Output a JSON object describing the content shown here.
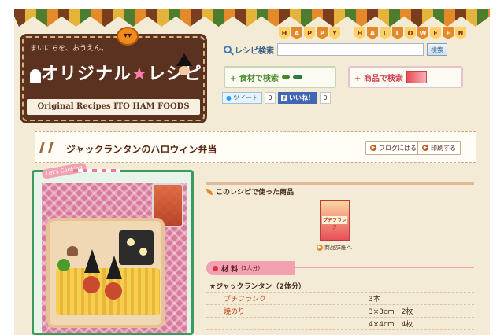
{
  "header": {
    "bunting_text": [
      "H",
      "A",
      "P",
      "P",
      "Y",
      " ",
      "H",
      "A",
      "L",
      "L",
      "O",
      "W",
      "E",
      "E",
      "N"
    ],
    "logo": {
      "tagline": "まいにちを、おうえん。",
      "title_a": "オリジナル",
      "title_star": "★",
      "title_b": "レシピ",
      "subtitle": "Original Recipes ITO HAM FOODS"
    }
  },
  "search": {
    "label": "レシピ検索",
    "input_value": "",
    "button": "検索"
  },
  "categories": {
    "ingredient": "+ 食材で検索",
    "product": "+ 商品で検索"
  },
  "social": {
    "tweet_label": "ツイート",
    "tweet_count": "0",
    "like_label": "いいね！",
    "like_count": "0"
  },
  "recipe": {
    "title": "ジャックランタンのハロウィン弁当",
    "blog_button": "ブログにはる",
    "print_button": "印刷する",
    "photo_tag": "Let's Cooking"
  },
  "used_products": {
    "heading": "このレシピで使った商品",
    "product_label": "プチフランク",
    "detail_link": "商品詳細へ"
  },
  "materials": {
    "heading": "材 料",
    "servings": "(1人分)",
    "items": [
      {
        "name": "★ジャックランタン（2体分）",
        "amount": "",
        "group": true
      },
      {
        "name": "プチフランク",
        "amount": "3本",
        "group": false
      },
      {
        "name": "焼のり",
        "amount": "3×3cm　2枚",
        "group": false
      },
      {
        "name": "",
        "amount": "4×4cm　4枚",
        "group": false
      }
    ]
  },
  "colors": {
    "logo_bg": "#5b3220",
    "page_bg": "#f4ebd6",
    "photo_border": "#3c9a5a",
    "materials_pink": "#f3a0b0",
    "accent_orange": "#e58a28"
  }
}
